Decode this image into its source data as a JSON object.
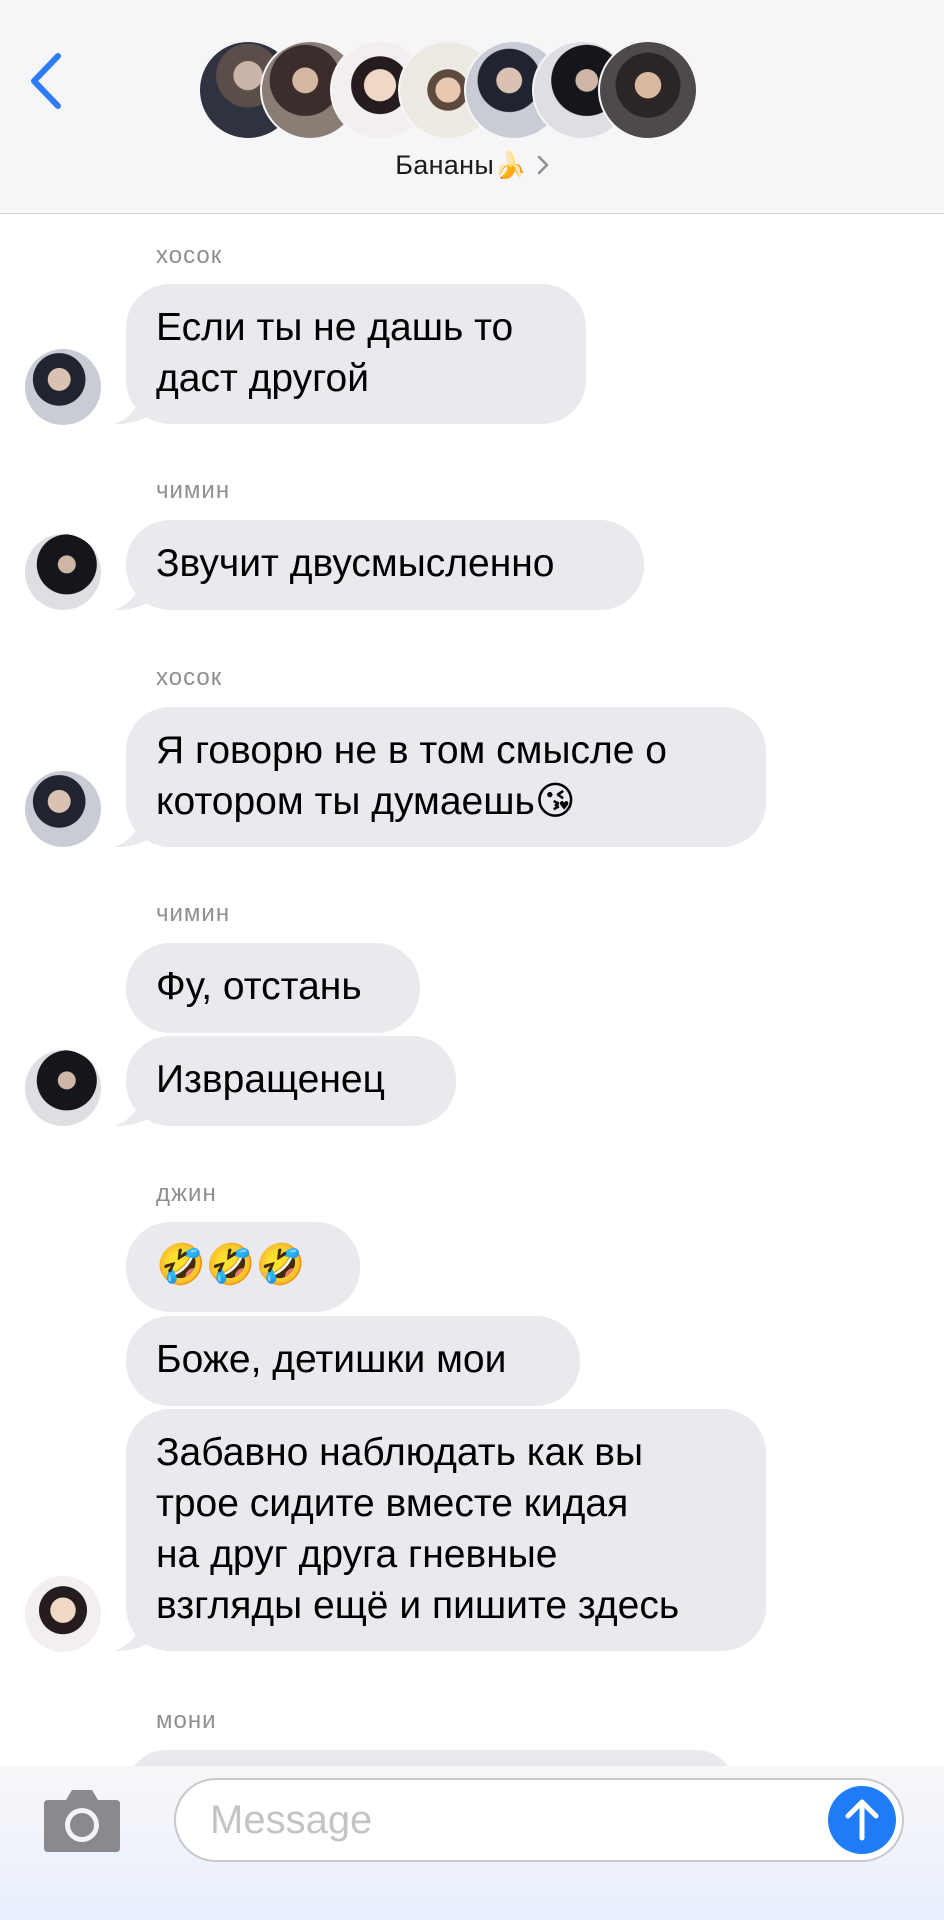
{
  "header": {
    "back_icon": "chevron-left-icon",
    "group_name": "Бананы",
    "group_emoji": "🍌",
    "disclosure_icon": "chevron-right-icon",
    "accent_color": "#2f7df6",
    "member_avatars": 7
  },
  "messages": [
    {
      "sender": "хосок",
      "bubbles": [
        "Если ты не дашь то\nдаст другой"
      ]
    },
    {
      "sender": "чимин",
      "bubbles": [
        "Звучит двусмысленно"
      ]
    },
    {
      "sender": "хосок",
      "bubbles": [
        "Я говорю не в том смысле о\nкотором ты думаешь😘"
      ]
    },
    {
      "sender": "чимин",
      "bubbles": [
        "Фу, отстань",
        "Извращенец"
      ]
    },
    {
      "sender": "джин",
      "bubbles": [
        "🤣🤣🤣",
        "Боже, детишки мои",
        "Забавно наблюдать как вы\nтрое сидите вместе кидая\nна друг друга гневные\nвзгляды ещё и пишите здесь"
      ]
    },
    {
      "sender": "мони",
      "bubbles": []
    }
  ],
  "composer": {
    "camera_icon": "camera-icon",
    "placeholder": "Message",
    "send_icon": "arrow-up-icon",
    "send_color": "#1f7bf6"
  },
  "colors": {
    "bubble_incoming": "#e9e9ee",
    "sender_label": "#8e8e93",
    "header_bg": "#f6f6f8"
  }
}
